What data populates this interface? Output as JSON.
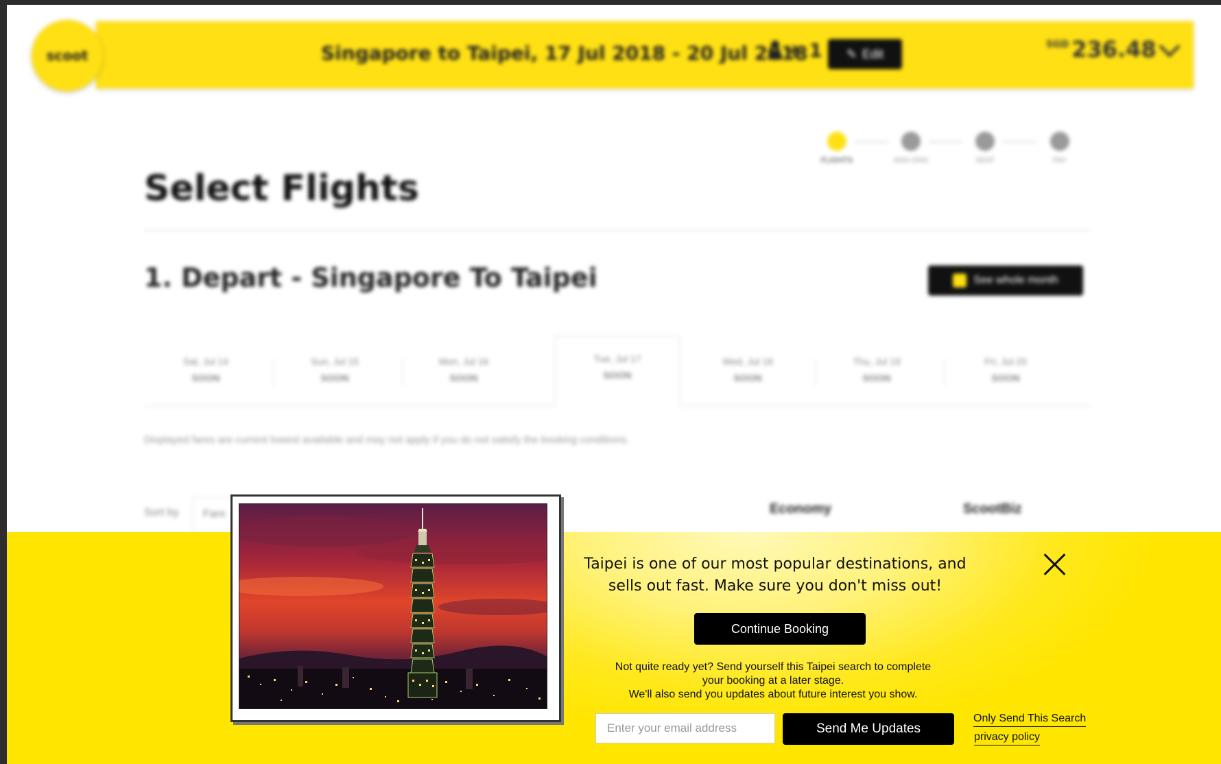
{
  "header": {
    "logo_text": "scoot",
    "route": "Singapore to Taipei, 17 Jul 2018 - 20 Jul 2018",
    "pax_count": "+ 1",
    "edit_label": "Edit",
    "price_currency": "SGD",
    "price": "236.48"
  },
  "steps": [
    {
      "label": "FLIGHTS"
    },
    {
      "label": "ADD-ONS"
    },
    {
      "label": "SEAT"
    },
    {
      "label": "PAY"
    }
  ],
  "page": {
    "title": "Select Flights",
    "section_title": "1. Depart - Singapore To Taipei",
    "month_button": "See whole month"
  },
  "dates": [
    {
      "day": "Sat, Jul 14",
      "fare": "SOON"
    },
    {
      "day": "Sun, Jul 15",
      "fare": "SOON"
    },
    {
      "day": "Mon, Jul 16",
      "fare": "SOON"
    },
    {
      "day": "Tue, Jul 17",
      "fare": "SOON"
    },
    {
      "day": "Wed, Jul 18",
      "fare": "SOON"
    },
    {
      "day": "Thu, Jul 19",
      "fare": "SOON"
    },
    {
      "day": "Fri, Jul 20",
      "fare": "SOON"
    }
  ],
  "note": "Displayed fares are current lowest available and may not apply if you do not satisfy the booking conditions.",
  "sort": {
    "label": "Sort by",
    "value": "Fare"
  },
  "columns": {
    "economy": "Economy",
    "scootbiz": "ScootBiz"
  },
  "popup": {
    "headline": "Taipei is one of our most popular destinations, and sells out fast. Make sure you don't miss out!",
    "continue_label": "Continue Booking",
    "info_line1": "Not quite ready yet? Send yourself this Taipei search to complete",
    "info_line2": "your booking at a later stage.",
    "info_line3": "We'll also send you updates about future interest you show.",
    "email_placeholder": "Enter your email address",
    "send_label": "Send Me Updates",
    "only_send_label": "Only Send This Search",
    "privacy_label": "privacy policy"
  },
  "colors": {
    "brand_yellow": "#ffe014",
    "button_black": "#000000"
  }
}
